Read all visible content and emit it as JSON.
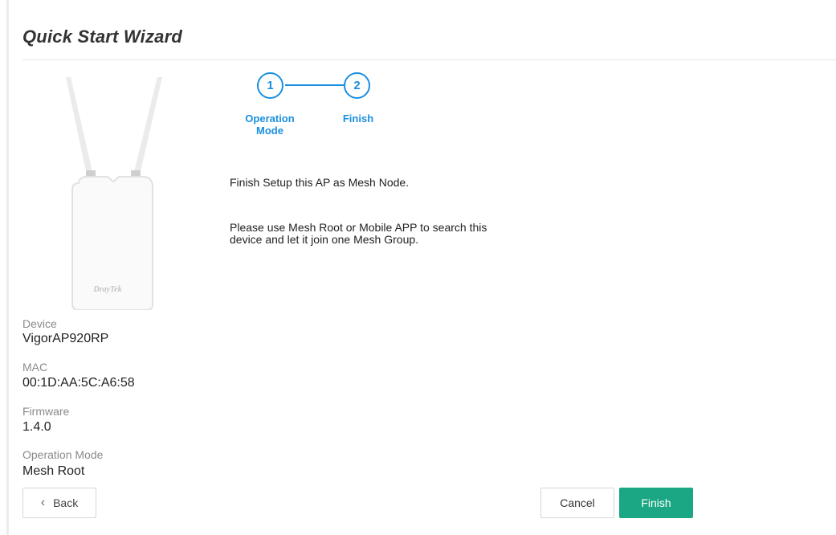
{
  "header": {
    "title": "Quick Start Wizard"
  },
  "device_image": {
    "brand_text": "DrayTek"
  },
  "device_info": {
    "device_label": "Device",
    "device_value": "VigorAP920RP",
    "mac_label": "MAC",
    "mac_value": "00:1D:AA:5C:A6:58",
    "firmware_label": "Firmware",
    "firmware_value": "1.4.0",
    "operation_mode_label": "Operation Mode",
    "operation_mode_value": "Mesh Root"
  },
  "steps": [
    {
      "number": "1",
      "label_line1": "Operation",
      "label_line2": "Mode"
    },
    {
      "number": "2",
      "label_line1": "Finish",
      "label_line2": ""
    }
  ],
  "content": {
    "line1": "Finish Setup this AP as Mesh Node.",
    "line2a": "Please use Mesh Root or Mobile APP to search this",
    "line2b": "device and let it join one Mesh Group."
  },
  "buttons": {
    "back": "Back",
    "cancel": "Cancel",
    "finish": "Finish"
  },
  "colors": {
    "accent_blue": "#1a8fe0",
    "finish_green": "#1ba784"
  }
}
